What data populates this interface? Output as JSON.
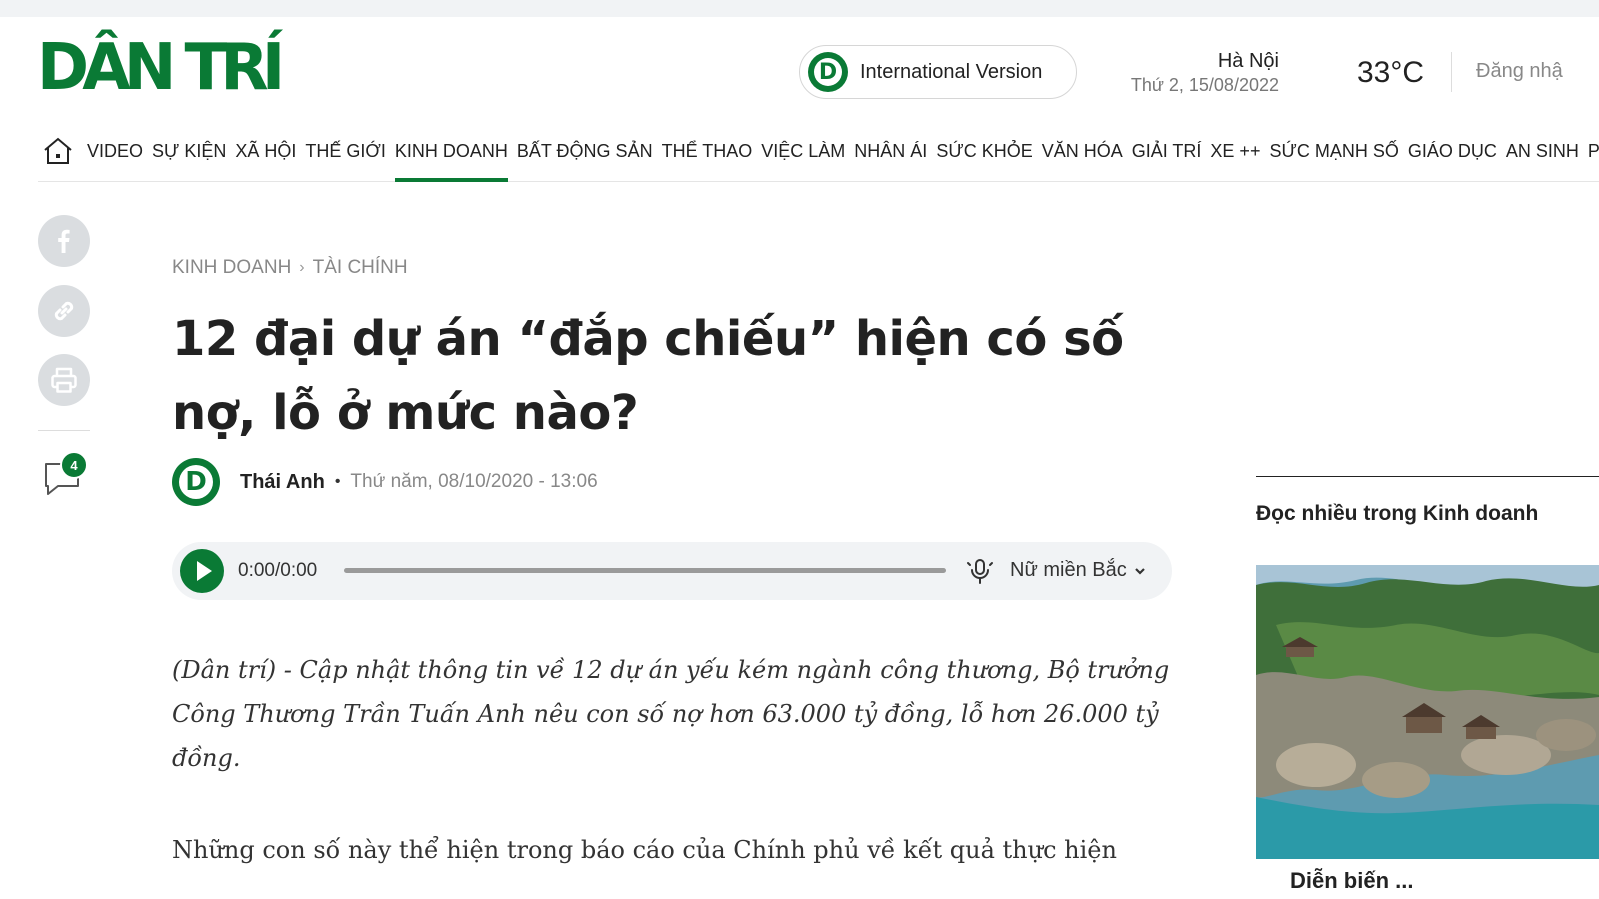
{
  "header": {
    "logo_text": "DÂN TRÍ",
    "intl_badge": "D",
    "intl_label": "International Version",
    "city": "Hà Nội",
    "date": "Thứ 2, 15/08/2022",
    "temperature": "33°C",
    "login": "Đăng nhậ"
  },
  "nav": {
    "items": [
      "VIDEO",
      "SỰ KIỆN",
      "XÃ HỘI",
      "THẾ GIỚI",
      "KINH DOANH",
      "BẤT ĐỘNG SẢN",
      "THỂ THAO",
      "VIỆC LÀM",
      "NHÂN ÁI",
      "SỨC KHỎE",
      "VĂN HÓA",
      "GIẢI TRÍ",
      "XE ++",
      "SỨC MẠNH SỐ",
      "GIÁO DỤC",
      "AN SINH",
      "PH"
    ],
    "active": "KINH DOANH"
  },
  "share": {
    "comment_count": "4",
    "icons": [
      "facebook-icon",
      "link-icon",
      "print-icon",
      "comment-icon"
    ]
  },
  "article": {
    "breadcrumb": [
      "KINH DOANH",
      "TÀI CHÍNH"
    ],
    "title": "12 đại dự án “đắp chiếu” hiện có số nợ, lỗ ở mức nào?",
    "author_badge": "D",
    "author": "Thái Anh",
    "published": "Thứ năm, 08/10/2020 - 13:06",
    "lead": "(Dân trí) - Cập nhật thông tin về 12 dự án yếu kém ngành công thương, Bộ trưởng Công Thương Trần Tuấn Anh nêu con số nợ hơn 63.000 tỷ đồng, lỗ hơn 26.000 tỷ đồng.",
    "body_start": "Những con số này thể hiện trong báo cáo của Chính phủ về kết quả thực hiện"
  },
  "audio": {
    "time": "0:00/0:00",
    "progress": 0,
    "voice": "Nữ miền Bắc"
  },
  "sidebar": {
    "heading": "Đọc nhiều trong Kinh doanh",
    "caption_start": "Diễn biến ..."
  },
  "colors": {
    "brand_green": "#0a7a35"
  }
}
